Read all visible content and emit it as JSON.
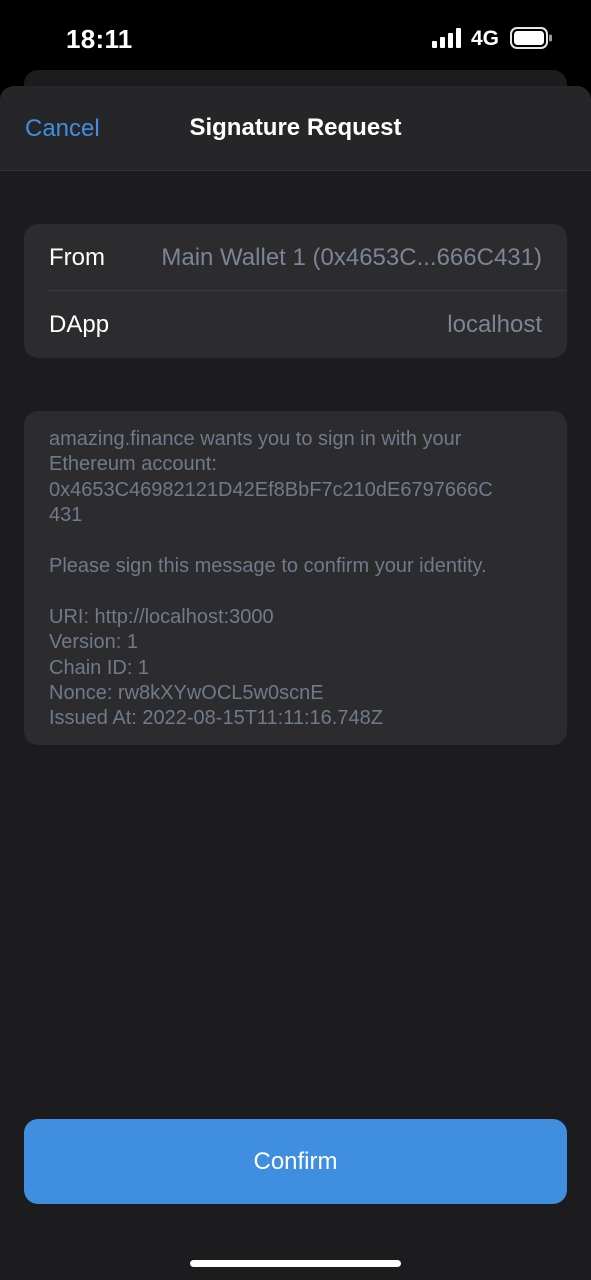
{
  "status_bar": {
    "time": "18:11",
    "network": "4G",
    "icons": [
      "signal-bars-icon",
      "battery-icon"
    ]
  },
  "sheet": {
    "cancel_label": "Cancel",
    "title": "Signature Request"
  },
  "details": {
    "from_label": "From",
    "from_value": "Main Wallet 1 (0x4653C...666C431)",
    "dapp_label": "DApp",
    "dapp_value": "localhost"
  },
  "message": {
    "lines": [
      "amazing.finance wants you to sign in with your",
      "Ethereum account:",
      "0x4653C46982121D42Ef8BbF7c210dE6797666C",
      "431",
      "",
      "Please sign this message to confirm your identity.",
      "",
      "URI: http://localhost:3000",
      "Version: 1",
      "Chain ID: 1",
      "Nonce: rw8kXYwOCL5w0scnE",
      "Issued At: 2022-08-15T11:11:16.748Z"
    ]
  },
  "actions": {
    "confirm_label": "Confirm"
  },
  "colors": {
    "accent": "#3f8ee0",
    "sheet_bg": "#1c1c1e",
    "card_bg": "#2c2c2e",
    "secondary_text": "#7b8596"
  }
}
